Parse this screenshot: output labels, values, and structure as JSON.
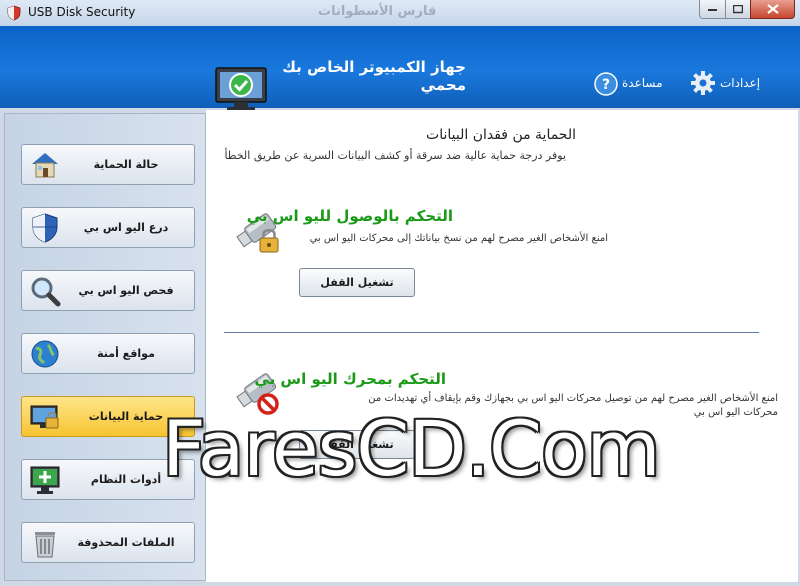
{
  "window": {
    "title": "USB Disk Security",
    "ghost_title": "فارس الأسطوانات"
  },
  "header": {
    "computer_title": "جهاز الكمبيوتر الخاص بك محمي",
    "help_label": "مساعدة",
    "settings_label": "إعدادات"
  },
  "sidebar": {
    "items": [
      {
        "label": "حالة الحماية",
        "icon": "house-icon"
      },
      {
        "label": "درع اليو اس بي",
        "icon": "shield-icon"
      },
      {
        "label": "فحص اليو اس بي",
        "icon": "magnifier-icon"
      },
      {
        "label": "مواقع أمنة",
        "icon": "globe-icon"
      },
      {
        "label": "حماية البيانات",
        "icon": "data-protection-icon",
        "active": true
      },
      {
        "label": "أدوات النظام",
        "icon": "system-tools-icon"
      },
      {
        "label": "الملفات المحذوفة",
        "icon": "trash-icon"
      }
    ]
  },
  "main": {
    "section_title": "الحماية من فقدان البيانات",
    "section_desc": "يوفر درجة حماية عالية ضد سرقة أو كشف البيانات السرية عن طريق الخطأ",
    "features": [
      {
        "title": "التحكم بالوصول لليو اس بي",
        "desc": "امنع الأشخاص الغير مصرح لهم من نسخ بياناتك إلى محركات اليو اس بي",
        "button": "تشغيل القفل"
      },
      {
        "title": "التحكم بمحرك اليو اس بي",
        "desc": "امنع الأشخاص الغير مصرح لهم من توصيل محركات اليو اس بي بجهازك وقم بإيقاف أي تهديدات من محركات اليو اس بي",
        "button": "تشغيل القفل"
      }
    ]
  },
  "watermark": "FaresCD.Com"
}
